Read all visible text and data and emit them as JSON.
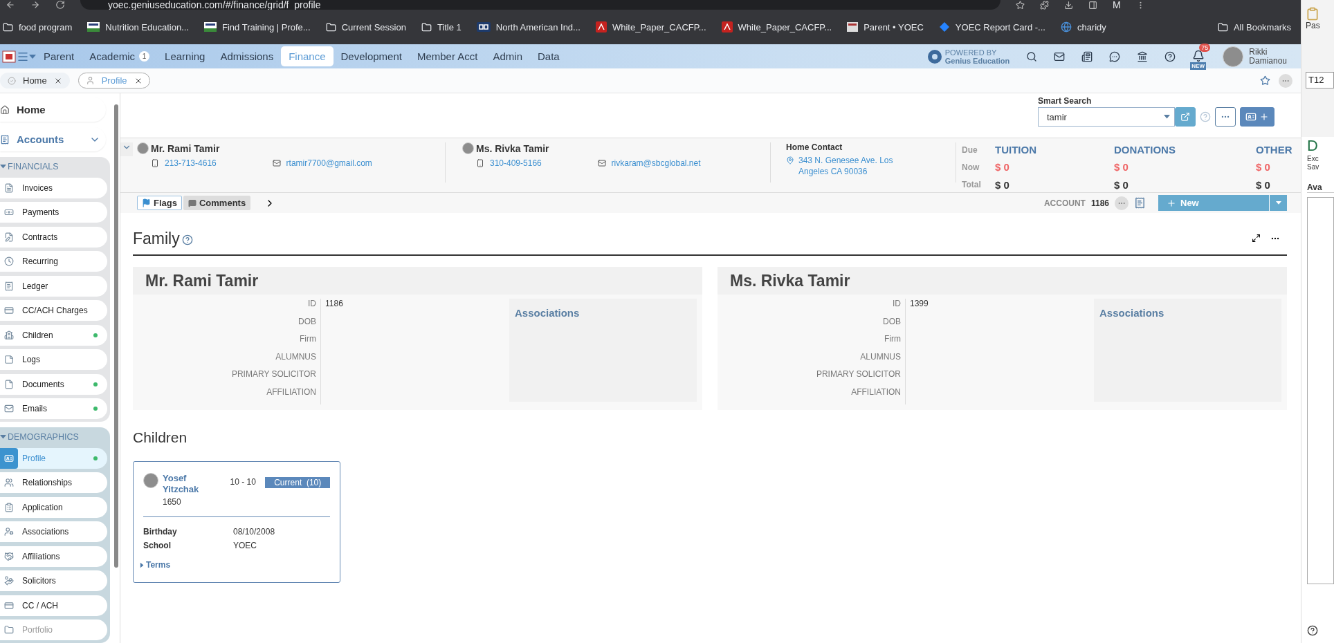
{
  "browser": {
    "url": "yoec.geniuseducation.com/#/finance/grid/f_profile",
    "profile_initial": "M",
    "bookmarks": [
      {
        "label": "food program",
        "kind": "folder"
      },
      {
        "label": "Nutrition Education...",
        "kind": "flag"
      },
      {
        "label": "Find Training | Profe...",
        "kind": "flag"
      },
      {
        "label": "Current Session",
        "kind": "folder"
      },
      {
        "label": "Title 1",
        "kind": "folder"
      },
      {
        "label": "North American Ind...",
        "kind": "cb"
      },
      {
        "label": "White_Paper_CACFP...",
        "kind": "pdf"
      },
      {
        "label": "White_Paper_CACFP...",
        "kind": "pdf"
      },
      {
        "label": "Parent • YOEC",
        "kind": "page"
      },
      {
        "label": "YOEC Report Card -...",
        "kind": "jira"
      },
      {
        "label": "charidy",
        "kind": "globe"
      }
    ],
    "all_bookmarks": "All Bookmarks"
  },
  "nav": {
    "items": [
      {
        "label": "Parent",
        "selected": false
      },
      {
        "label": "Academic",
        "badge": "1",
        "selected": false
      },
      {
        "label": "Learning",
        "selected": false
      },
      {
        "label": "Admissions",
        "selected": false
      },
      {
        "label": "Finance",
        "selected": true
      },
      {
        "label": "Development",
        "selected": false
      },
      {
        "label": "Member Acct",
        "selected": false
      },
      {
        "label": "Admin",
        "selected": false
      },
      {
        "label": "Data",
        "selected": false
      }
    ],
    "powered_by": "POWERED BY",
    "brand": "Genius Education",
    "notification_count": "75",
    "new_badge": "NEW",
    "user_first": "Rikki",
    "user_last": "Damianou"
  },
  "tabs": [
    {
      "label": "Home",
      "selected": false
    },
    {
      "label": "Profile",
      "selected": true
    }
  ],
  "sidebar": {
    "home": "Home",
    "accounts": {
      "label": "Accounts",
      "expanded": true
    },
    "groups": [
      {
        "title": "FINANCIALS",
        "items": [
          {
            "label": "Invoices",
            "dot": false,
            "selected": false,
            "disabled": false
          },
          {
            "label": "Payments",
            "dot": false,
            "selected": false,
            "disabled": false
          },
          {
            "label": "Contracts",
            "dot": false,
            "selected": false,
            "disabled": false
          },
          {
            "label": "Recurring",
            "dot": false,
            "selected": false,
            "disabled": false
          },
          {
            "label": "Ledger",
            "dot": false,
            "selected": false,
            "disabled": false
          },
          {
            "label": "CC/ACH Charges",
            "dot": false,
            "selected": false,
            "disabled": false
          },
          {
            "label": "Children",
            "dot": true,
            "selected": false,
            "disabled": false
          },
          {
            "label": "Logs",
            "dot": false,
            "selected": false,
            "disabled": false
          },
          {
            "label": "Documents",
            "dot": true,
            "selected": false,
            "disabled": false
          },
          {
            "label": "Emails",
            "dot": true,
            "selected": false,
            "disabled": false
          }
        ]
      },
      {
        "title": "DEMOGRAPHICS",
        "items": [
          {
            "label": "Profile",
            "dot": true,
            "selected": true,
            "disabled": false
          },
          {
            "label": "Relationships",
            "dot": false,
            "selected": false,
            "disabled": false
          },
          {
            "label": "Application",
            "dot": false,
            "selected": false,
            "disabled": false
          },
          {
            "label": "Associations",
            "dot": false,
            "selected": false,
            "disabled": false
          },
          {
            "label": "Affiliations",
            "dot": false,
            "selected": false,
            "disabled": false
          },
          {
            "label": "Solicitors",
            "dot": false,
            "selected": false,
            "disabled": false
          },
          {
            "label": "CC / ACH",
            "dot": false,
            "selected": false,
            "disabled": false
          },
          {
            "label": "Portfolio",
            "dot": false,
            "selected": false,
            "disabled": true
          }
        ]
      }
    ]
  },
  "smart_search": {
    "label": "Smart Search",
    "value": "tamir"
  },
  "summary": {
    "contacts": [
      {
        "name": "Mr. Rami Tamir",
        "phone": "213-713-4616",
        "email": "rtamir7700@gmail.com"
      },
      {
        "name": "Ms. Rivka Tamir",
        "phone": "310-409-5166",
        "email": "rivkaram@sbcglobal.net"
      }
    ],
    "home_contact": {
      "label": "Home Contact",
      "address": "343 N. Genesee Ave. Los Angeles CA 90036"
    },
    "row_labels": [
      "Due",
      "Now",
      "Total"
    ],
    "balances": [
      {
        "title": "TUITION",
        "now": "$ 0",
        "total": "$ 0"
      },
      {
        "title": "DONATIONS",
        "now": "$ 0",
        "total": "$ 0"
      },
      {
        "title": "OTHER",
        "now": "$ 0",
        "total": "$ 0"
      }
    ]
  },
  "toolbar": {
    "tabs": [
      {
        "label": "Flags",
        "selected": true
      },
      {
        "label": "Comments",
        "selected": false
      }
    ],
    "account_label": "ACCOUNT",
    "account_number": "1186",
    "new_button": "New"
  },
  "family": {
    "title": "Family",
    "members": [
      {
        "name": "Mr. Rami Tamir",
        "associations": "Associations",
        "fields": [
          {
            "label": "ID",
            "value": "1186"
          },
          {
            "label": "DOB"
          },
          {
            "label": "Firm"
          },
          {
            "label": "ALUMNUS"
          },
          {
            "label": "PRIMARY SOLICITOR"
          },
          {
            "label": "AFFILIATION"
          }
        ]
      },
      {
        "name": "Ms. Rivka Tamir",
        "associations": "Associations",
        "fields": [
          {
            "label": "ID",
            "value": "1399"
          },
          {
            "label": "DOB"
          },
          {
            "label": "Firm"
          },
          {
            "label": "ALUMNUS"
          },
          {
            "label": "PRIMARY SOLICITOR"
          },
          {
            "label": "AFFILIATION"
          }
        ]
      }
    ]
  },
  "children": {
    "title": "Children",
    "cards": [
      {
        "first": "Yosef",
        "last": "Yitzchak",
        "id": "1650",
        "grade": "10 - 10",
        "status": "Current  (10)",
        "details": [
          {
            "label": "Birthday",
            "value": "08/10/2008"
          },
          {
            "label": "School",
            "value": "YOEC"
          }
        ],
        "terms": "Terms"
      }
    ]
  },
  "side_panel": {
    "paste": "Pas",
    "cell": "T12",
    "heading": "D",
    "lines": [
      "Exc",
      "Sav"
    ],
    "label": "Ava"
  }
}
